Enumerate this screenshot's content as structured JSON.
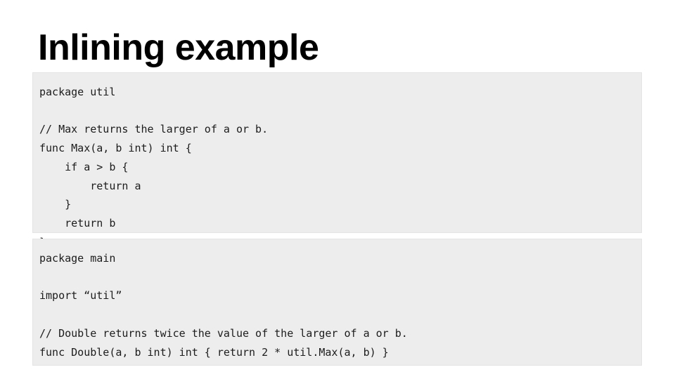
{
  "slide": {
    "title": "Inlining example",
    "background_color": "#ffffff",
    "title_color": "#000000"
  },
  "code_blocks": [
    {
      "id": "util",
      "language": "go",
      "background_color": "#ededed",
      "text_color": "#1c1c1c",
      "code": "package util\n\n// Max returns the larger of a or b.\nfunc Max(a, b int) int {\n    if a > b {\n        return a\n    }\n    return b\n}"
    },
    {
      "id": "main",
      "language": "go",
      "background_color": "#ededed",
      "text_color": "#1c1c1c",
      "code": "package main\n\nimport “util”\n\n// Double returns twice the value of the larger of a or b.\nfunc Double(a, b int) int { return 2 * util.Max(a, b) }"
    }
  ]
}
